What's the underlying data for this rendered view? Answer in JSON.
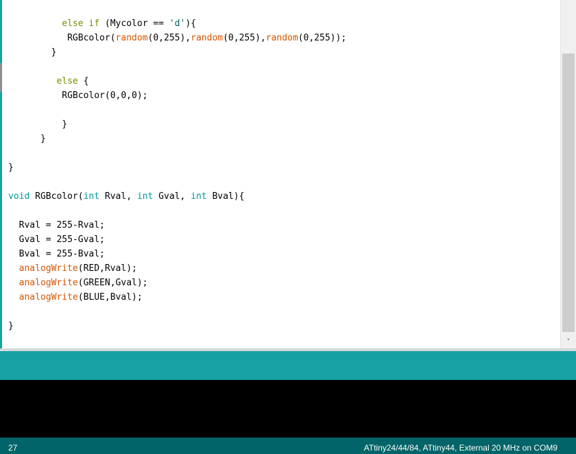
{
  "editor": {
    "lines": [
      [
        {
          "t": "          "
        },
        {
          "t": "else",
          "c": "kw"
        },
        {
          "t": " "
        },
        {
          "t": "if",
          "c": "kw"
        },
        {
          "t": " (Mycolor == "
        },
        {
          "t": "'d'",
          "c": "st"
        },
        {
          "t": "){"
        }
      ],
      [
        {
          "t": "           RGBcolor("
        },
        {
          "t": "random",
          "c": "fn"
        },
        {
          "t": "(0,255),"
        },
        {
          "t": "random",
          "c": "fn"
        },
        {
          "t": "(0,255),"
        },
        {
          "t": "random",
          "c": "fn"
        },
        {
          "t": "(0,255));"
        }
      ],
      [
        {
          "t": "        }"
        }
      ],
      [
        {
          "t": ""
        }
      ],
      [
        {
          "t": "         "
        },
        {
          "t": "else",
          "c": "kw"
        },
        {
          "t": " {"
        }
      ],
      [
        {
          "t": "          RGBcolor(0,0,0);"
        }
      ],
      [
        {
          "t": ""
        }
      ],
      [
        {
          "t": "          }"
        }
      ],
      [
        {
          "t": "      }"
        }
      ],
      [
        {
          "t": ""
        }
      ],
      [
        {
          "t": "}"
        }
      ],
      [
        {
          "t": ""
        }
      ],
      [
        {
          "t": "void",
          "c": "ty"
        },
        {
          "t": " RGBcolor("
        },
        {
          "t": "int",
          "c": "ty"
        },
        {
          "t": " Rval, "
        },
        {
          "t": "int",
          "c": "ty"
        },
        {
          "t": " Gval, "
        },
        {
          "t": "int",
          "c": "ty"
        },
        {
          "t": " Bval){"
        }
      ],
      [
        {
          "t": ""
        }
      ],
      [
        {
          "t": "  Rval = 255-Rval;"
        }
      ],
      [
        {
          "t": "  Gval = 255-Gval;"
        }
      ],
      [
        {
          "t": "  Bval = 255-Bval;"
        }
      ],
      [
        {
          "t": "  "
        },
        {
          "t": "analogWrite",
          "c": "fn"
        },
        {
          "t": "(RED,Rval);"
        }
      ],
      [
        {
          "t": "  "
        },
        {
          "t": "analogWrite",
          "c": "fn"
        },
        {
          "t": "(GREEN,Gval);"
        }
      ],
      [
        {
          "t": "  "
        },
        {
          "t": "analogWrite",
          "c": "fn"
        },
        {
          "t": "(BLUE,Bval);"
        }
      ],
      [
        {
          "t": ""
        }
      ],
      [
        {
          "t": "}"
        }
      ]
    ]
  },
  "scrollbar": {
    "down_arrow": "˅"
  },
  "status": {
    "line_number": "27",
    "board": "ATtiny24/44/84, ATtiny44, External 20 MHz on COM9"
  },
  "colors": {
    "keyword": "#728e00",
    "type": "#00979c",
    "function": "#d35400",
    "string": "#005c5f",
    "message_bar": "#17a1a5",
    "status_bar": "#006468",
    "console": "#000000"
  }
}
